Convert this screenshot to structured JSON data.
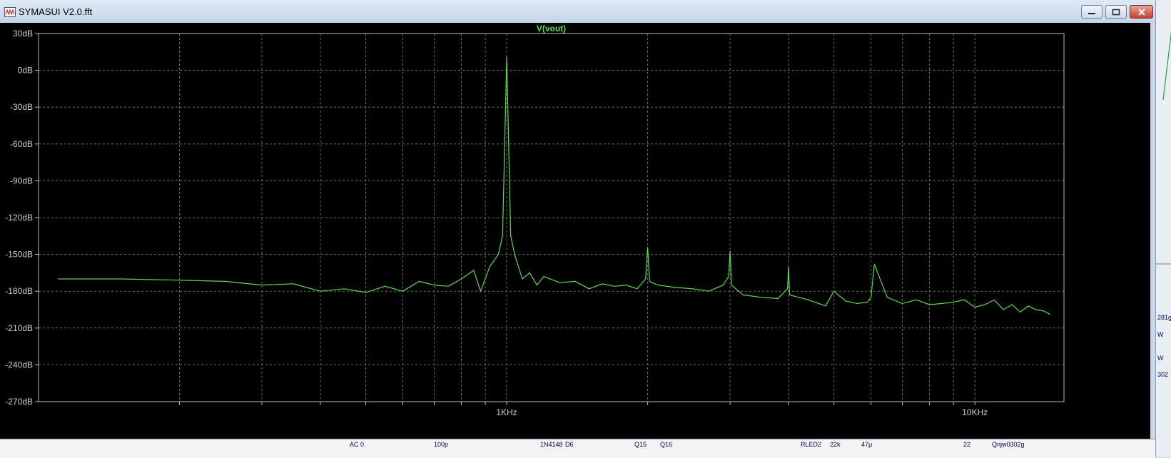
{
  "window": {
    "title": "SYMASUI V2.0.fft",
    "buttons": {
      "minimize": "minimize",
      "maximize": "maximize",
      "close": "close"
    }
  },
  "colors": {
    "trace": "#5cdc4a",
    "axis_text": "#cfcfcf",
    "grid": "#6f6f6f",
    "plot_bg": "#000000"
  },
  "chart_data": {
    "type": "line",
    "title": "V(vout)",
    "series": [
      {
        "name": "V(vout)",
        "x": [
          110,
          150,
          200,
          250,
          300,
          350,
          400,
          450,
          500,
          550,
          600,
          650,
          700,
          750,
          800,
          850,
          880,
          920,
          960,
          980,
          1000,
          1020,
          1040,
          1080,
          1120,
          1160,
          1200,
          1300,
          1400,
          1500,
          1600,
          1700,
          1800,
          1900,
          1980,
          2000,
          2020,
          2100,
          2300,
          2500,
          2700,
          2900,
          2980,
          3000,
          3020,
          3200,
          3500,
          3800,
          3980,
          4000,
          4020,
          4400,
          4800,
          5000,
          5300,
          5600,
          5900,
          6000,
          6100,
          6500,
          7000,
          7500,
          8000,
          8500,
          9000,
          9500,
          10000,
          10500,
          11000,
          11500,
          12000,
          12500,
          13000,
          13500,
          14000,
          14500
        ],
        "y": [
          -170,
          -170,
          -171,
          -172,
          -175,
          -174,
          -180,
          -178,
          -181,
          -176,
          -180,
          -172,
          -175,
          -176,
          -170,
          -163,
          -180,
          -160,
          -150,
          -135,
          11,
          -135,
          -150,
          -170,
          -165,
          -175,
          -168,
          -173,
          -172,
          -178,
          -174,
          -176,
          -175,
          -178,
          -170,
          -144,
          -172,
          -175,
          -177,
          -178,
          -180,
          -175,
          -168,
          -147,
          -175,
          -183,
          -185,
          -186,
          -178,
          -160,
          -183,
          -187,
          -192,
          -180,
          -188,
          -190,
          -189,
          -185,
          -158,
          -185,
          -190,
          -187,
          -191,
          -190,
          -189,
          -187,
          -193,
          -191,
          -187,
          -195,
          -191,
          -197,
          -192,
          -195,
          -196,
          -199
        ]
      }
    ],
    "xscale": "log",
    "xlim": [
      100,
      15500
    ],
    "ylim": [
      -270,
      30
    ],
    "x_tick_labels": [
      "1KHz",
      "10KHz"
    ],
    "x_ticks": [
      1000,
      10000
    ],
    "x_minor_ticks": [
      200,
      300,
      400,
      500,
      600,
      700,
      800,
      900,
      2000,
      3000,
      4000,
      5000,
      6000,
      7000,
      8000,
      9000
    ],
    "y_ticks": [
      30,
      0,
      -30,
      -60,
      -90,
      -120,
      -150,
      -180,
      -210,
      -240,
      -270
    ],
    "y_tick_labels": [
      "30dB",
      "0dB",
      "-30dB",
      "-60dB",
      "-90dB",
      "-120dB",
      "-150dB",
      "-180dB",
      "-210dB",
      "-240dB",
      "-270dB"
    ],
    "grid": true
  },
  "schematic_fragments": {
    "bottom": [
      "AC 0",
      "100p",
      "1N4148",
      "D6",
      "Q15",
      "Q16",
      "RLED2",
      "22k",
      "47μ",
      "22",
      "Qnjw0302g"
    ],
    "right": [
      "281g",
      "W",
      "W",
      "302"
    ]
  }
}
